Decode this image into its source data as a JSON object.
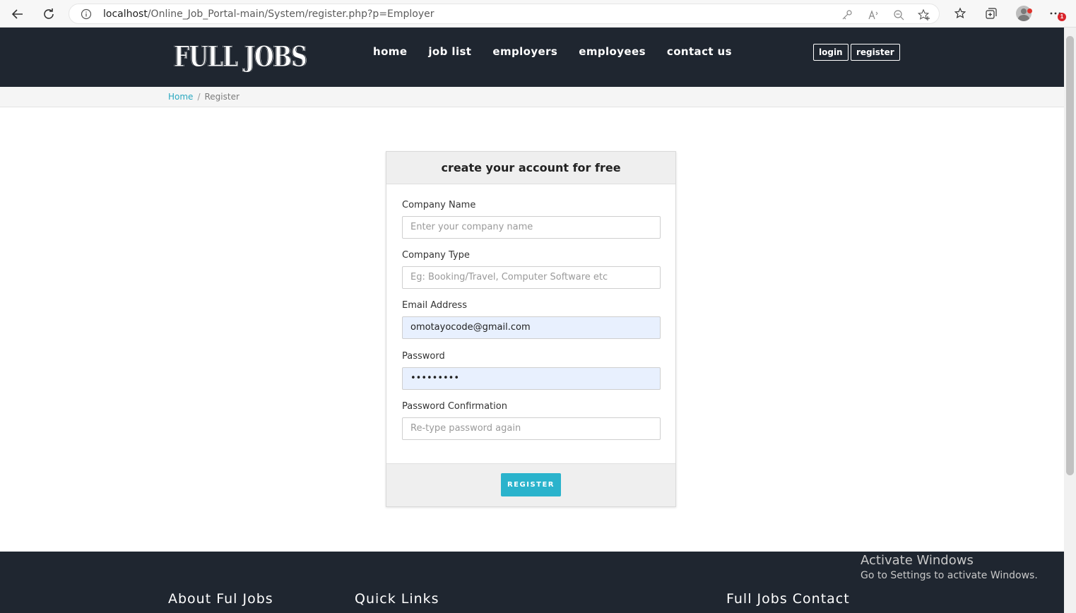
{
  "browser": {
    "url_host": "localhost",
    "url_path": "/Online_Job_Portal-main/System/register.php?p=Employer",
    "notification_count": "1"
  },
  "header": {
    "logo": "FULL JOBS",
    "menu": [
      "home",
      "job list",
      "employers",
      "employees",
      "contact us"
    ],
    "login_label": "login",
    "register_label": "register"
  },
  "breadcrumb": {
    "home": "Home",
    "current": "Register"
  },
  "form": {
    "title": "create your account for free",
    "company_name": {
      "label": "Company Name",
      "placeholder": "Enter your company name",
      "value": ""
    },
    "company_type": {
      "label": "Company Type",
      "placeholder": "Eg: Booking/Travel, Computer Software etc",
      "value": ""
    },
    "email": {
      "label": "Email Address",
      "value": "omotayocode@gmail.com"
    },
    "password": {
      "label": "Password",
      "value": "•••••••••"
    },
    "password_confirm": {
      "label": "Password Confirmation",
      "placeholder": "Re-type password again",
      "value": ""
    },
    "submit_label": "REGISTER"
  },
  "footer": {
    "about": "About Ful Jobs",
    "links": "Quick Links",
    "contact": "Full Jobs Contact"
  },
  "watermark": {
    "title": "Activate Windows",
    "subtitle": "Go to Settings to activate Windows."
  },
  "colors": {
    "header_bg": "#1f2630",
    "accent": "#2ab3cc",
    "autofill_bg": "#e8f0fe"
  }
}
